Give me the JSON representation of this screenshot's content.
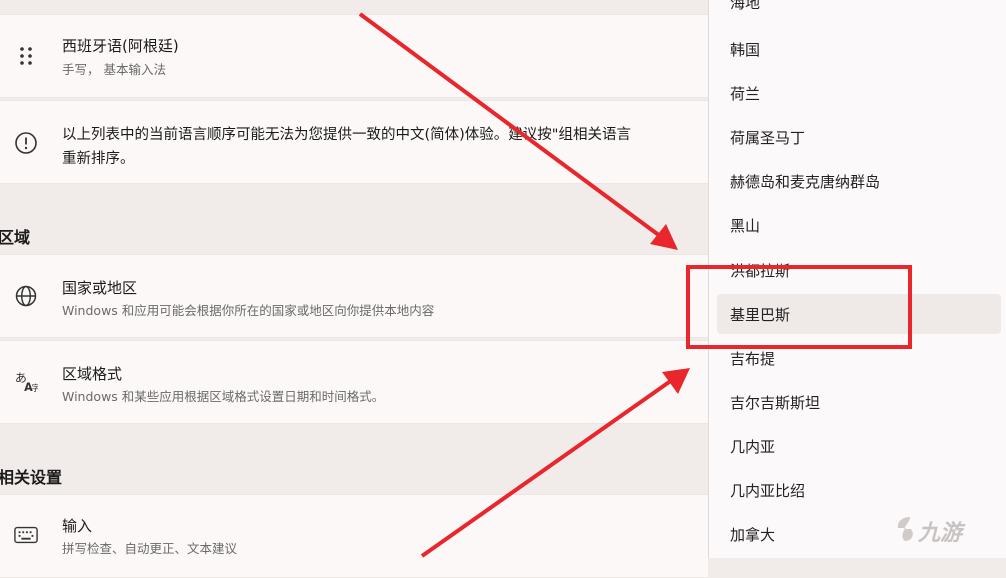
{
  "language_item": {
    "title": "西班牙语(阿根廷)",
    "subtitle": "手写， 基本输入法"
  },
  "notice": {
    "line1": "以上列表中的当前语言顺序可能无法为您提供一致的中文(简体)体验。建议按\"组相关语言",
    "line2": "重新排序。"
  },
  "section_region": "区域",
  "country": {
    "title": "国家或地区",
    "subtitle": "Windows 和应用可能会根据你所在的国家或地区向你提供本地内容"
  },
  "region_format": {
    "title": "区域格式",
    "subtitle": "Windows 和某些应用根据区域格式设置日期和时间格式。"
  },
  "section_related": "相关设置",
  "input": {
    "title": "输入",
    "subtitle": "拼写检查、自动更正、文本建议"
  },
  "dropdown": {
    "items": [
      "海地",
      "韩国",
      "荷兰",
      "荷属圣马丁",
      "赫德岛和麦克唐纳群岛",
      "黑山",
      "洪都拉斯",
      "基里巴斯",
      "吉布提",
      "吉尔吉斯斯坦",
      "几内亚",
      "几内亚比绍",
      "加拿大"
    ],
    "selected": "基里巴斯"
  },
  "watermark": "九游",
  "colors": {
    "annotation_red": "#e8262b",
    "card_bg": "#fbf8f7",
    "page_bg": "#f1ebe9"
  }
}
